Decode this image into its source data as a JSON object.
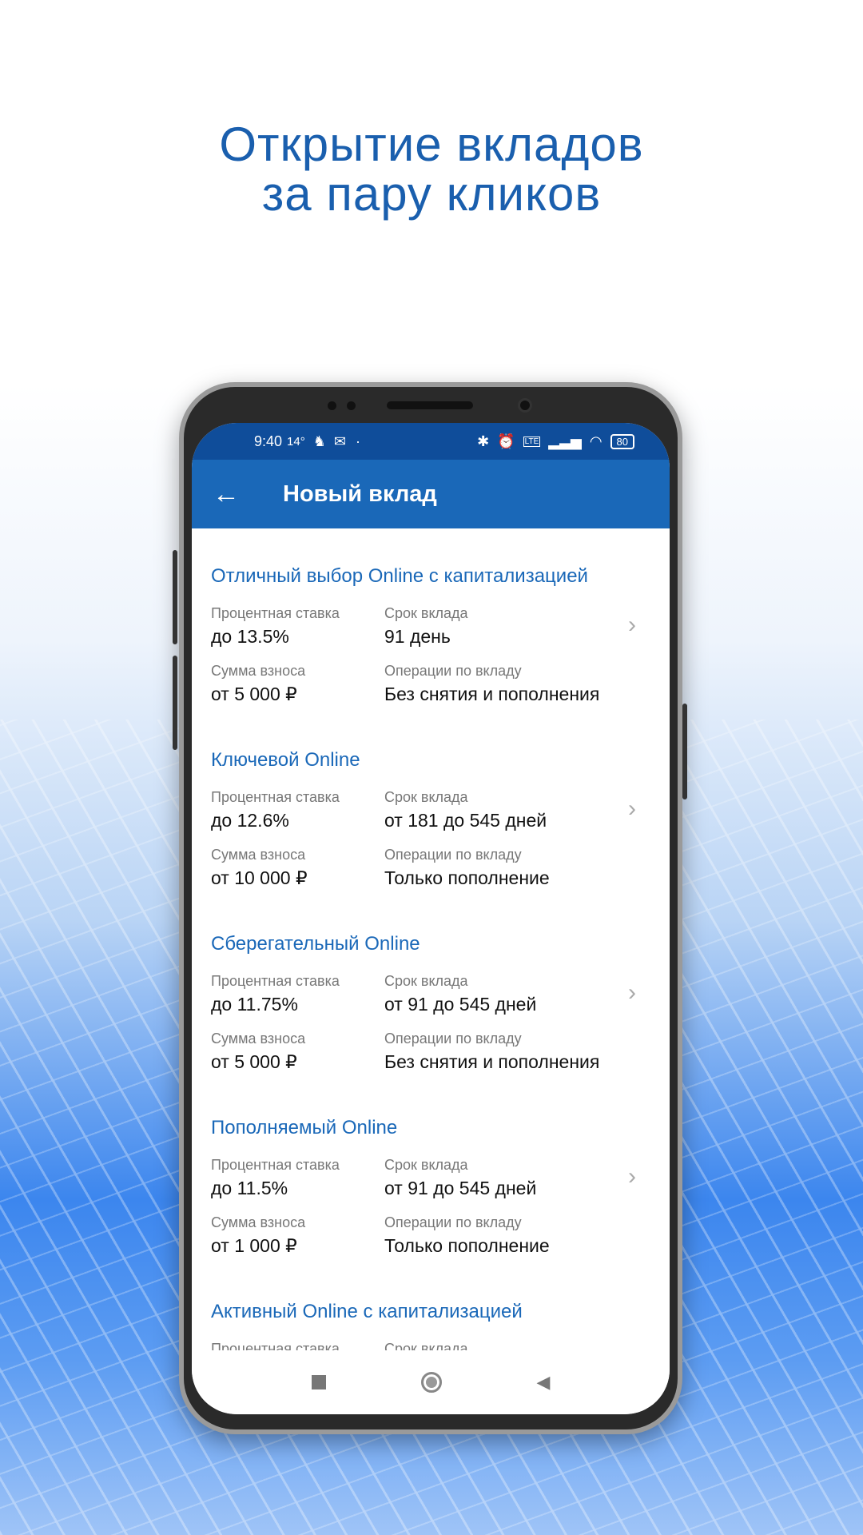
{
  "headline": {
    "line1": "Открытие вкладов",
    "line2": "за пару кликов"
  },
  "status_bar": {
    "time": "9:40",
    "temperature": "14°",
    "battery": "80",
    "icons": [
      "person-icon",
      "mail-icon",
      "bluetooth-icon",
      "alarm-icon",
      "volte-icon",
      "signal-icon",
      "wifi-icon",
      "battery-icon"
    ]
  },
  "app_bar": {
    "title": "Новый вклад",
    "back_icon": "arrow-left-icon"
  },
  "labels": {
    "rate": "Процентная ставка",
    "term": "Срок вклада",
    "amount": "Сумма взноса",
    "operations": "Операции по вкладу"
  },
  "deposits": [
    {
      "title": "Отличный выбор Online с капитализацией",
      "rate": "до 13.5%",
      "term": "91 день",
      "amount": "от 5 000 ₽",
      "operations": "Без снятия и пополнения"
    },
    {
      "title": "Ключевой Online",
      "rate": "до 12.6%",
      "term": "от 181 до 545 дней",
      "amount": "от 10 000 ₽",
      "operations": "Только пополнение"
    },
    {
      "title": "Сберегательный Online",
      "rate": "до 11.75%",
      "term": "от 91 до 545 дней",
      "amount": "от 5 000 ₽",
      "operations": "Без снятия и пополнения"
    },
    {
      "title": "Пополняемый Online",
      "rate": "до 11.5%",
      "term": "от 91 до 545 дней",
      "amount": "от 1 000 ₽",
      "operations": "Только пополнение"
    },
    {
      "title": "Активный Online с капитализацией"
    }
  ],
  "colors": {
    "accent": "#1a68b8",
    "status_bar": "#0f4d9a",
    "headline": "#1a5fae"
  }
}
